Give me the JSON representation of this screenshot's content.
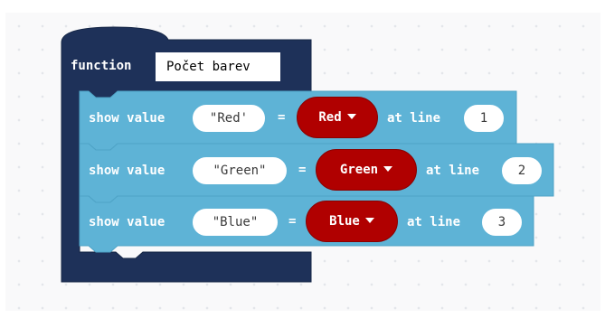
{
  "function_block": {
    "keyword": "function",
    "name": "Počet barev",
    "color": "#1e3159"
  },
  "statement_color": "#5eb3d6",
  "dropdown_color": "#b00000",
  "statements": [
    {
      "show_label": "show value",
      "string_value": "\"Red'",
      "equals": "=",
      "color_value": "Red",
      "at_label": "at line",
      "line": "1",
      "caret_icon": "dropdown-caret-icon"
    },
    {
      "show_label": "show value",
      "string_value": "\"Green\"",
      "equals": "=",
      "color_value": "Green",
      "at_label": "at line",
      "line": "2",
      "caret_icon": "dropdown-caret-icon"
    },
    {
      "show_label": "show value",
      "string_value": "\"Blue\"",
      "equals": "=",
      "color_value": "Blue",
      "at_label": "at line",
      "line": "3",
      "caret_icon": "dropdown-caret-icon"
    }
  ]
}
